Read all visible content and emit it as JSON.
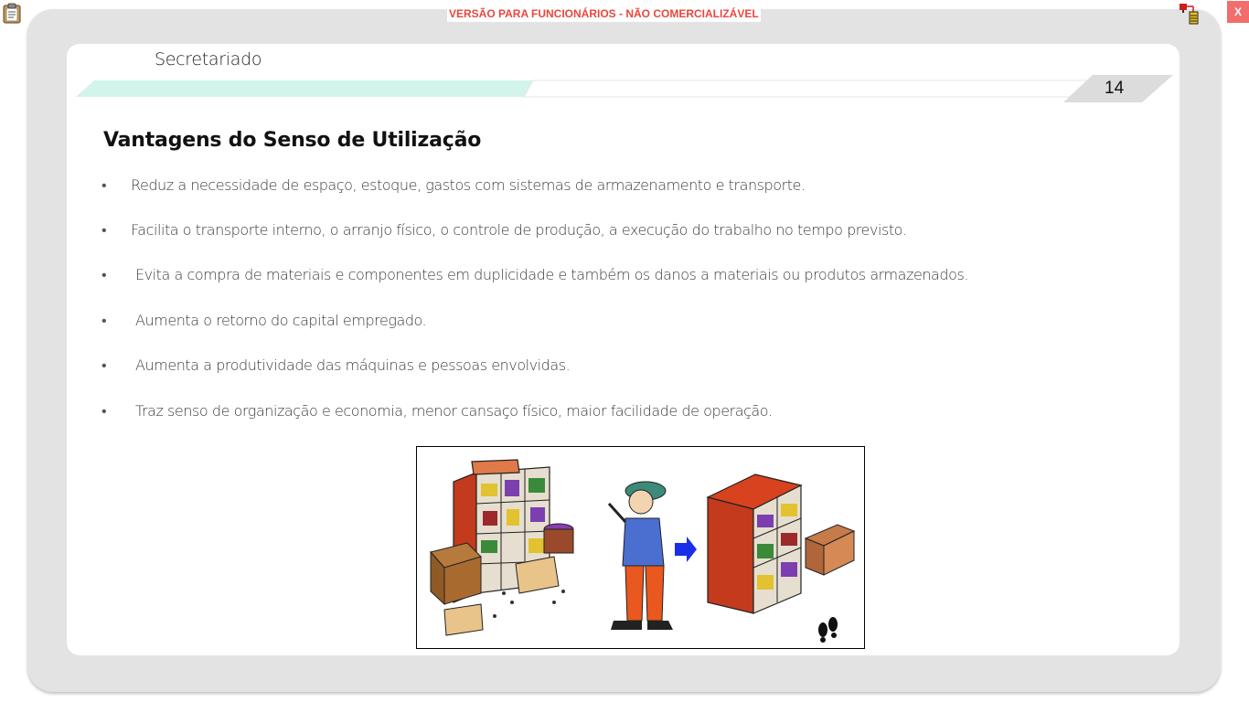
{
  "app": {
    "watermark": "VERSÃO PARA FUNCIONÁRIOS - NÃO COMERCIALIZÁVEL",
    "close_label": "X",
    "icons": [
      "clipboard-icon",
      "network-icon",
      "close-icon"
    ]
  },
  "slide": {
    "header_title": "Secretariado",
    "page_number": "14",
    "heading": "Vantagens do Senso de Utilização",
    "bullet_symbol": "•",
    "bullets": [
      "Reduz a necessidade de espaço, estoque, gastos com sistemas de armazenamento e transporte.",
      "Facilita o transporte interno, o arranjo físico, o controle de produção, a execução do trabalho no tempo previsto.",
      "Evita a compra de materiais e componentes em duplicidade e também os danos a materiais ou produtos armazenados.",
      "Aumenta o retorno do capital empregado.",
      "Aumenta a produtividade das máquinas e pessoas envolvidas.",
      "Traz senso de organização e economia, menor cansaço físico, maior facilidade de operação."
    ],
    "illustration": {
      "icons": [
        "messy-shelf-image",
        "worker-image",
        "arrow-right-icon",
        "organized-shelf-image",
        "footprints-icon"
      ]
    }
  },
  "colors": {
    "ribbon_accent": "#d2f4ea",
    "watermark_red": "#e8473e",
    "close_red": "#f26d6d",
    "frame_gray": "#e3e3e3"
  }
}
